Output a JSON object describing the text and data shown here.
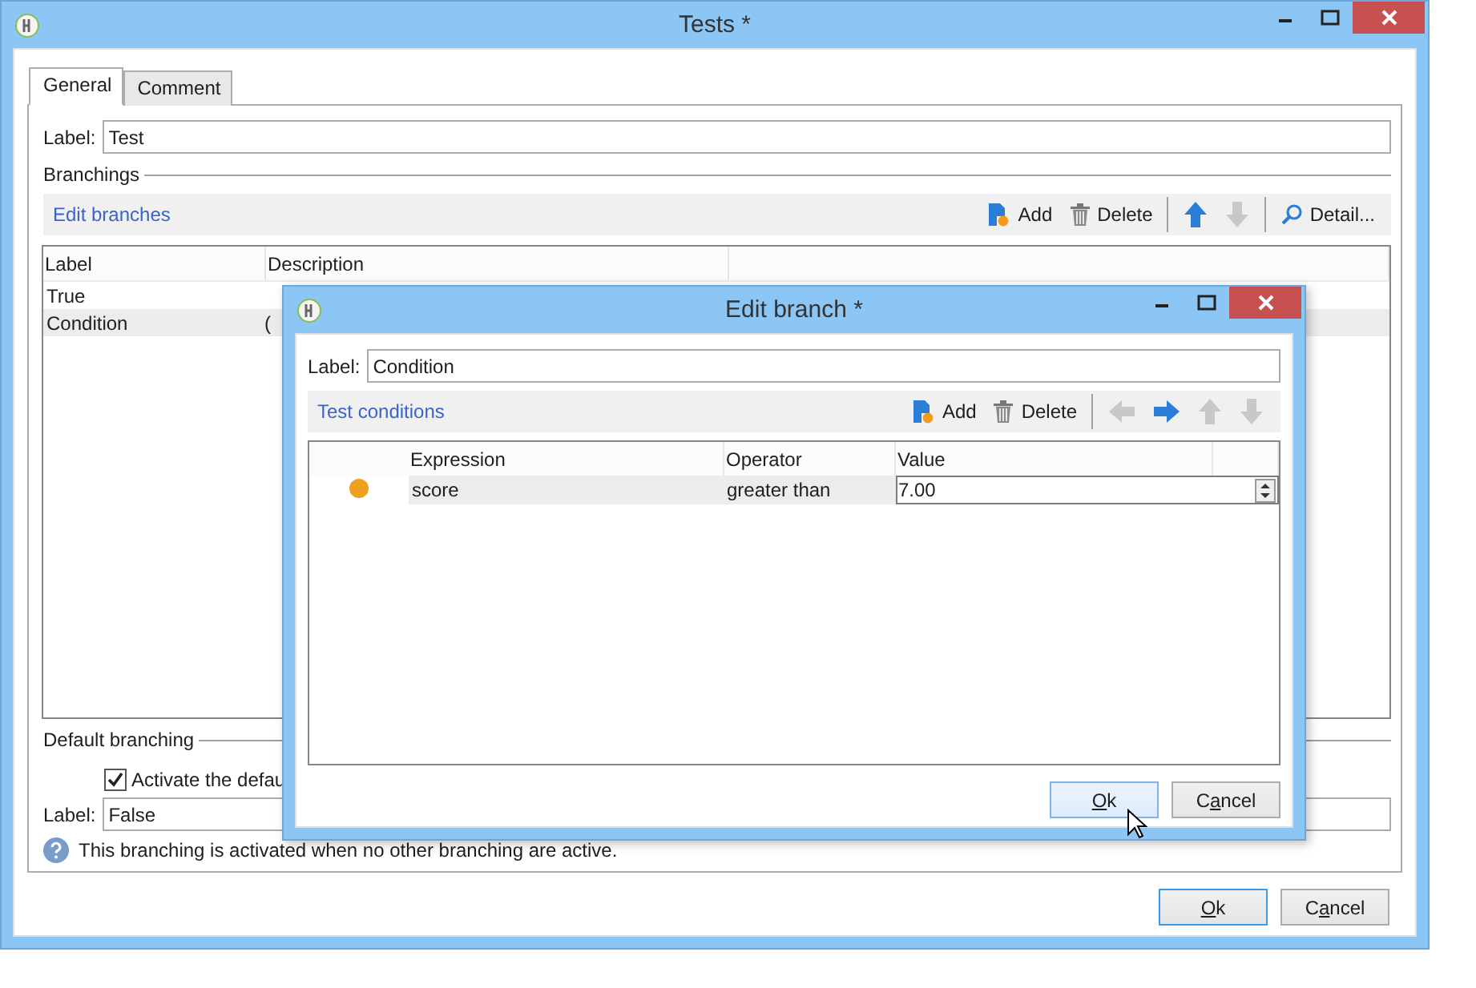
{
  "main_window": {
    "title": "Tests *",
    "tabs": [
      {
        "label": "General",
        "selected": true
      },
      {
        "label": "Comment",
        "selected": false
      }
    ],
    "label_field": {
      "label": "Label:",
      "value": "Test"
    },
    "branchings_section": "Branchings",
    "toolbar": {
      "link": "Edit branches",
      "buttons": [
        {
          "kind": "add",
          "label": "Add",
          "disabled": false
        },
        {
          "kind": "delete",
          "label": "Delete",
          "disabled": false
        },
        {
          "kind": "separator"
        },
        {
          "kind": "up",
          "disabled": false
        },
        {
          "kind": "down",
          "disabled": true
        },
        {
          "kind": "separator"
        },
        {
          "kind": "detail",
          "label": "Detail...",
          "disabled": false
        }
      ]
    },
    "table": {
      "columns": [
        "Label",
        "Description"
      ],
      "rows": [
        {
          "label": "True",
          "selected": false
        },
        {
          "label": "Condition",
          "description": "(",
          "selected": true
        }
      ]
    },
    "default_branching": {
      "section": "Default branching",
      "checkbox": {
        "label": "Activate the defau",
        "checked": true
      },
      "label_field": {
        "label": "Label:",
        "value": "False"
      },
      "info": "This branching is activated when no other branching are active."
    },
    "buttons": [
      {
        "access_key": "O",
        "label_after": "k",
        "default": true
      },
      {
        "label_before": "C",
        "access_key": "a",
        "label_after": "ncel",
        "default": false
      }
    ]
  },
  "dialog": {
    "title": "Edit branch *",
    "label_field": {
      "label": "Label:",
      "value": "Condition"
    },
    "toolbar": {
      "link": "Test conditions",
      "buttons": [
        {
          "kind": "add",
          "label": "Add",
          "disabled": false
        },
        {
          "kind": "delete",
          "label": "Delete",
          "disabled": false
        },
        {
          "kind": "separator"
        },
        {
          "kind": "left",
          "disabled": true
        },
        {
          "kind": "right",
          "disabled": false
        },
        {
          "kind": "up",
          "disabled": true
        },
        {
          "kind": "down",
          "disabled": true
        }
      ]
    },
    "table": {
      "columns": [
        "Expression",
        "Operator",
        "Value"
      ],
      "rows": [
        {
          "color": "#f0a020",
          "expression": "score",
          "operator": "greater than",
          "value": "7.00",
          "selected": true
        }
      ]
    },
    "buttons": [
      {
        "access_key": "O",
        "label_after": "k",
        "hovered": true
      },
      {
        "label_before": "C",
        "access_key": "a",
        "label_after": "ncel",
        "hovered": false
      }
    ]
  }
}
